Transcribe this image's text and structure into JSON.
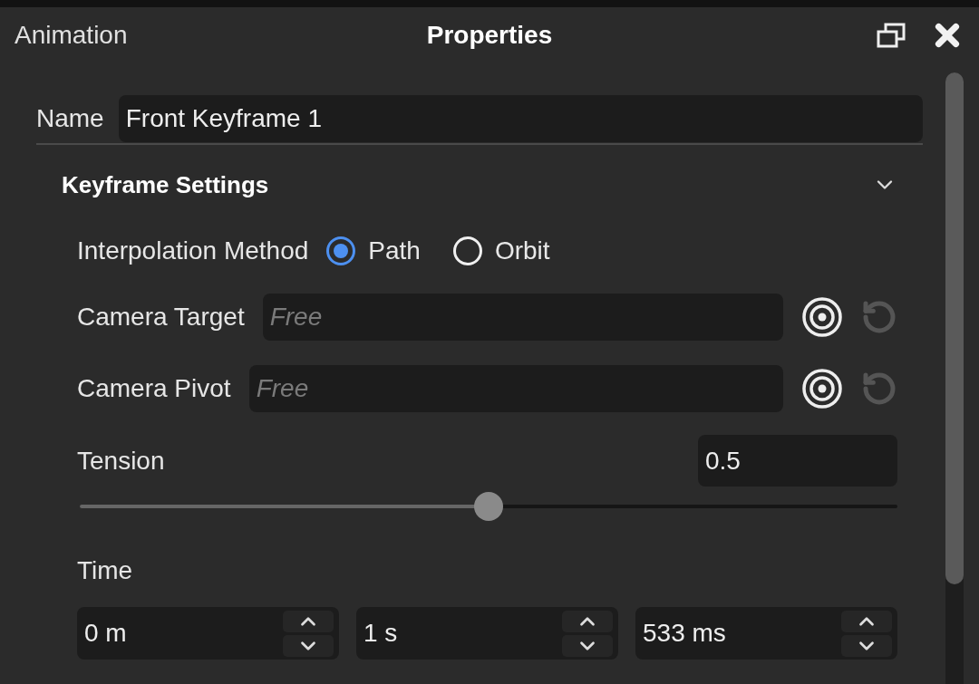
{
  "header": {
    "tab": "Animation",
    "title": "Properties"
  },
  "name_field": {
    "label": "Name",
    "value": "Front Keyframe 1"
  },
  "section": {
    "title": "Keyframe Settings",
    "expanded": true
  },
  "interpolation": {
    "label": "Interpolation Method",
    "options": [
      {
        "label": "Path",
        "selected": true
      },
      {
        "label": "Orbit",
        "selected": false
      }
    ]
  },
  "camera_fields": [
    {
      "label": "Camera Target",
      "placeholder": "Free"
    },
    {
      "label": "Camera Pivot",
      "placeholder": "Free"
    }
  ],
  "tension": {
    "label": "Tension",
    "value": "0.5",
    "level": 0.5
  },
  "time": {
    "label": "Time",
    "fields": [
      {
        "value": "0 m"
      },
      {
        "value": "1 s"
      },
      {
        "value": "533 ms"
      }
    ]
  }
}
